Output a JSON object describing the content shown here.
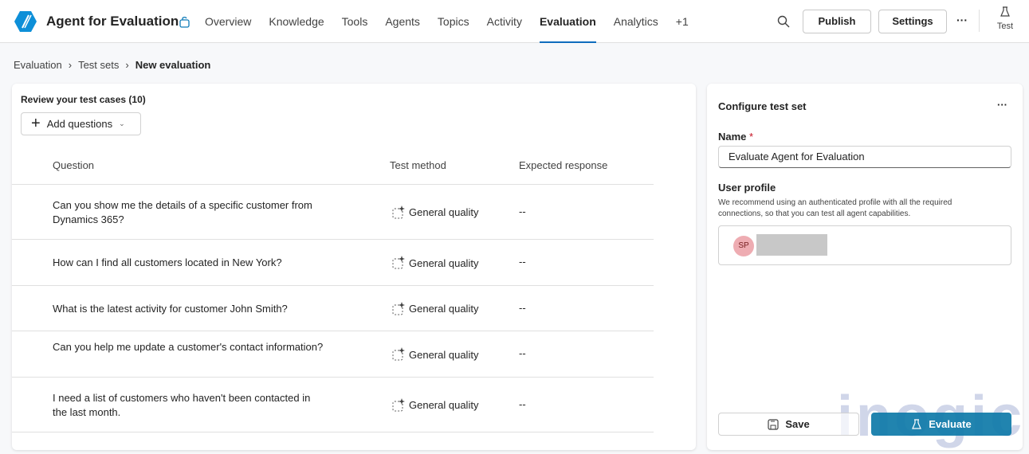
{
  "header": {
    "title": "Agent for Evaluation",
    "tabs": [
      "Overview",
      "Knowledge",
      "Tools",
      "Agents",
      "Topics",
      "Activity",
      "Evaluation",
      "Analytics",
      "+1"
    ],
    "active_tab": "Evaluation",
    "publish": "Publish",
    "settings": "Settings",
    "more": "···",
    "test": "Test"
  },
  "breadcrumb": [
    "Evaluation",
    "Test sets",
    "New evaluation"
  ],
  "test_cases": {
    "title": "Review your test cases (10)",
    "add_label": "Add questions",
    "columns": [
      "Question",
      "Test method",
      "Expected response"
    ],
    "rows": [
      {
        "question": "Can you show me the details of a specific customer from Dynamics 365?",
        "method": "General quality",
        "expected": "--"
      },
      {
        "question": "How can I find all customers located in New York?",
        "method": "General quality",
        "expected": "--"
      },
      {
        "question": "What is the latest activity for customer John Smith?",
        "method": "General quality",
        "expected": "--"
      },
      {
        "question": "Can you help me update a customer's contact information?",
        "method": "General quality",
        "expected": "--"
      },
      {
        "question": "I need a list of customers who haven't been contacted in the last month.",
        "method": "General quality",
        "expected": "--"
      }
    ]
  },
  "config": {
    "title": "Configure test set",
    "more": "···",
    "name_label": "Name",
    "required": "*",
    "name_value": "Evaluate Agent for Evaluation",
    "profile_label": "User profile",
    "profile_hint": "We recommend using an authenticated profile with all the required connections, so that you can test all agent capabilities.",
    "avatar_initials": "SP",
    "save": "Save",
    "evaluate": "Evaluate"
  },
  "watermark": "inogic",
  "colors": {
    "accent": "#0f6cbd",
    "evaluate": "#0e7aa8"
  }
}
